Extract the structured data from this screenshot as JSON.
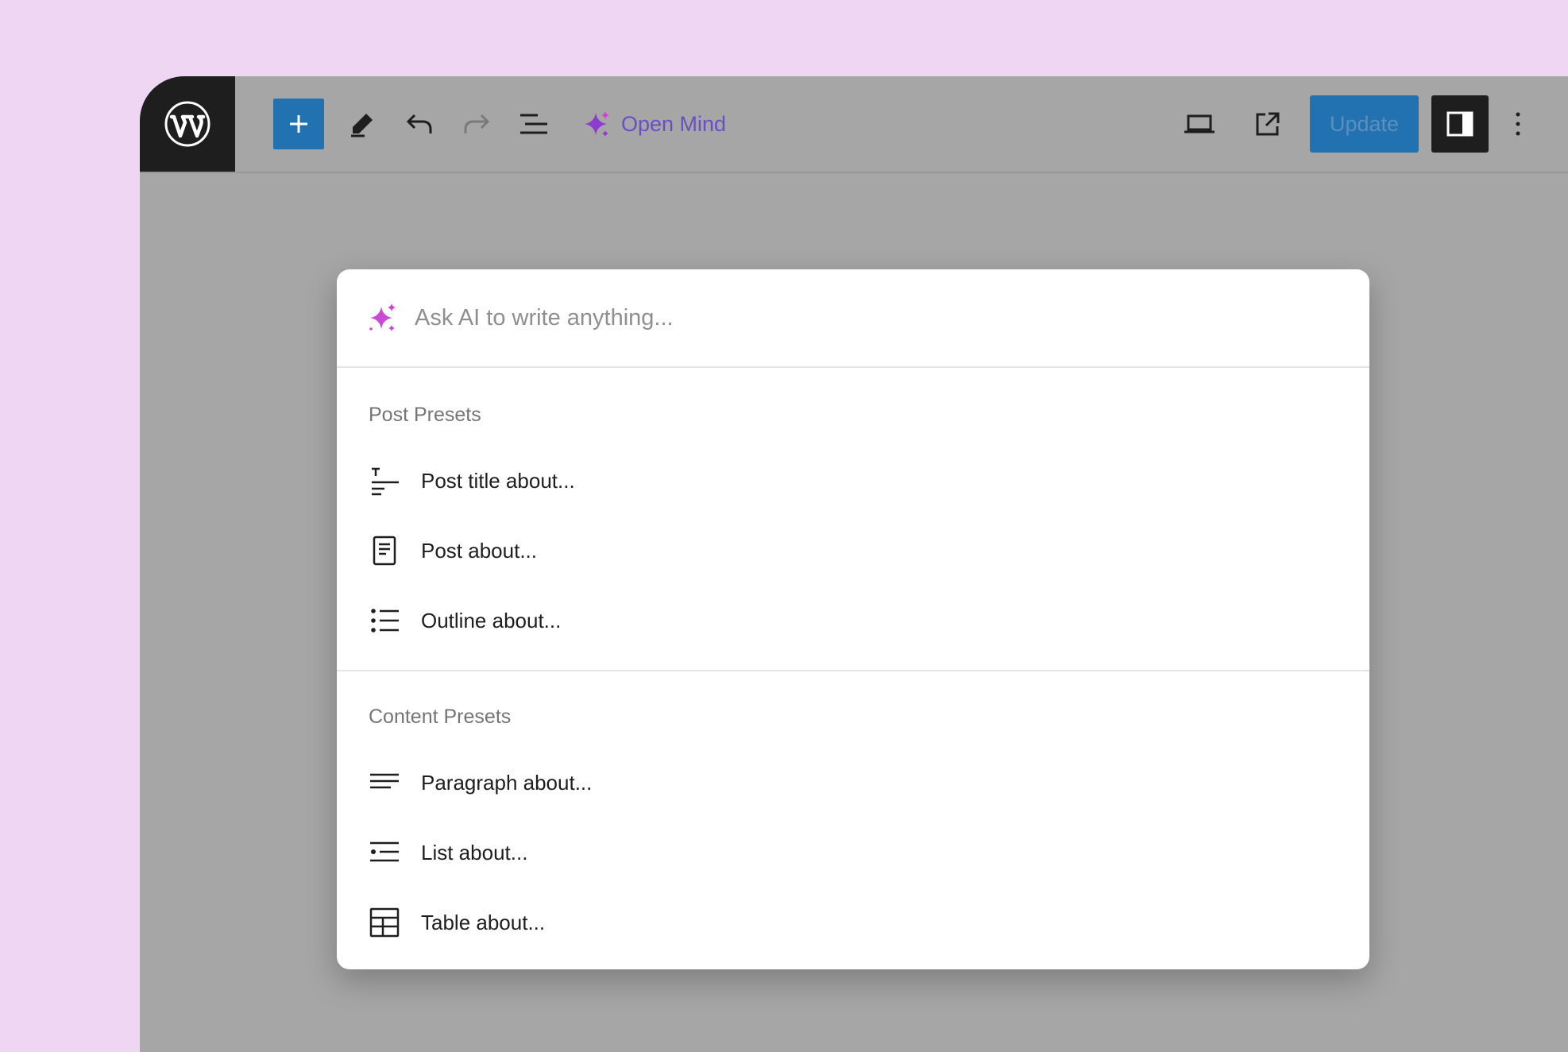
{
  "toolbar": {
    "add_icon": "plus-icon",
    "tools_icon": "pencil-icon",
    "undo_icon": "undo-icon",
    "redo_icon": "redo-icon",
    "list_view_icon": "list-view-icon",
    "brand_label": "Open Mind",
    "preview_icon": "laptop-icon",
    "view_post_icon": "external-link-icon",
    "update_label": "Update",
    "settings_icon": "sidebar-icon",
    "options_icon": "more-vertical-icon"
  },
  "dialog": {
    "search_placeholder": "Ask AI to write anything...",
    "sections": [
      {
        "title": "Post Presets",
        "items": [
          {
            "label": "Post title about...",
            "icon": "title-icon"
          },
          {
            "label": "Post about...",
            "icon": "document-icon"
          },
          {
            "label": "Outline about...",
            "icon": "bullet-list-icon"
          }
        ]
      },
      {
        "title": "Content Presets",
        "items": [
          {
            "label": "Paragraph about...",
            "icon": "paragraph-icon"
          },
          {
            "label": "List about...",
            "icon": "list-icon"
          },
          {
            "label": "Table about...",
            "icon": "table-icon"
          }
        ]
      }
    ]
  },
  "colors": {
    "background": "#efd7f4",
    "editor_gray": "#a6a6a6",
    "wp_blue": "#2271b1",
    "brand_purple": "#6a4fc4",
    "sparkle_pink": "#d63fd2"
  }
}
